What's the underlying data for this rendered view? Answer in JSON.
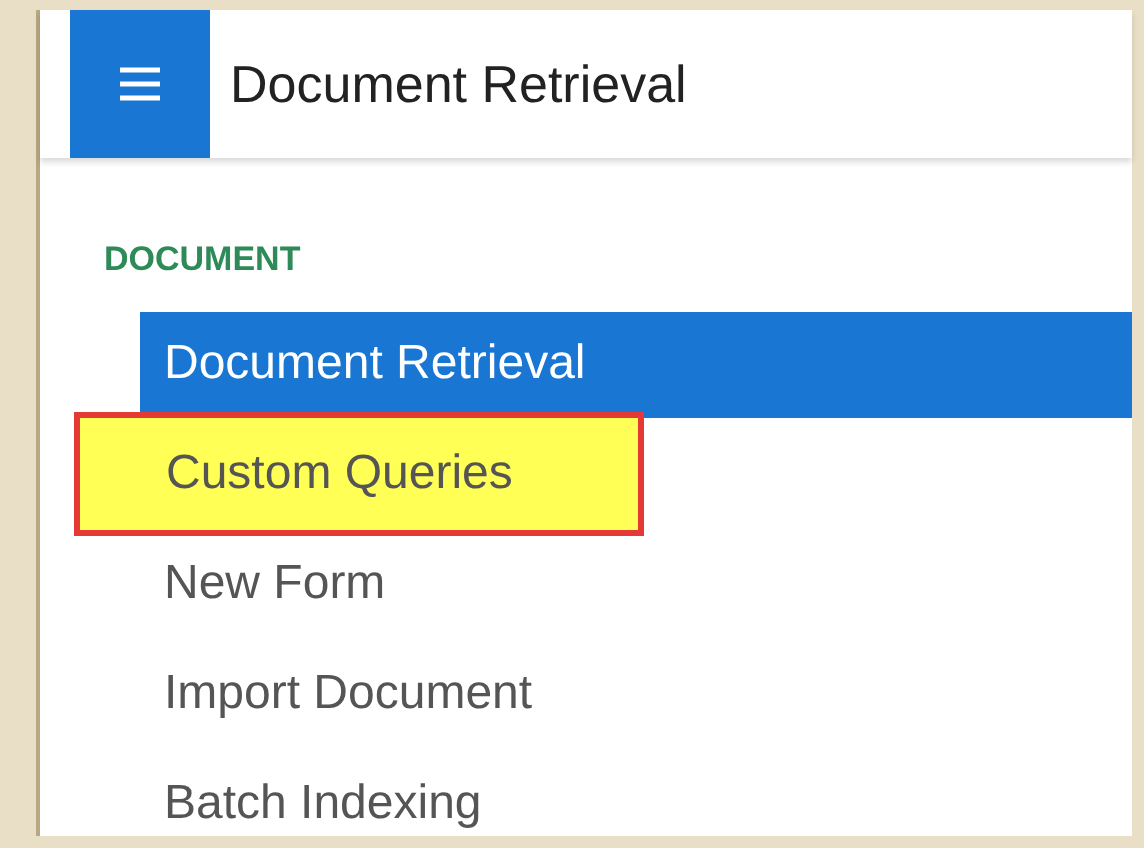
{
  "header": {
    "title": "Document Retrieval"
  },
  "section": {
    "heading": "DOCUMENT"
  },
  "items": [
    {
      "label": "Document Retrieval",
      "selected": true,
      "highlighted": false
    },
    {
      "label": "Custom Queries",
      "selected": false,
      "highlighted": true
    },
    {
      "label": "New Form",
      "selected": false,
      "highlighted": false
    },
    {
      "label": "Import Document",
      "selected": false,
      "highlighted": false
    },
    {
      "label": "Batch Indexing",
      "selected": false,
      "highlighted": false
    }
  ]
}
